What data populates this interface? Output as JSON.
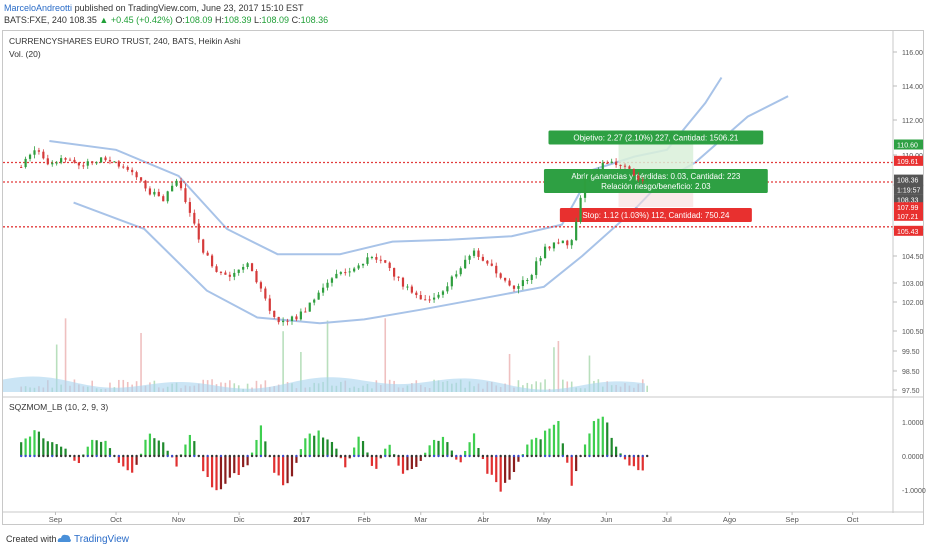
{
  "header": {
    "author": "MarceloAndreotti",
    "published": "published on TradingView.com, June 23, 2017 15:10 EST",
    "symbol_line": "BATS:FXE, 240",
    "last": "108.35",
    "change": "▲ +0.45 (+0.42%)",
    "ohlc": [
      {
        "k": "O:",
        "v": "108.09"
      },
      {
        "k": "H:",
        "v": "108.39"
      },
      {
        "k": "L:",
        "v": "108.09"
      },
      {
        "k": "C:",
        "v": "108.36"
      }
    ]
  },
  "panel": {
    "title": "CURRENCYSHARES EURO TRUST, 240, BATS, Heikin Ashi",
    "volume_label": "Vol. (20)",
    "osc_label": "SQZMOM_LB (10, 2, 9, 3)"
  },
  "colors": {
    "up": "#2e9e3e",
    "down": "#d53a3a",
    "band": "#a8c3e8",
    "hline": "#e23b3b",
    "target_fill": "#d9f0d9",
    "target_box": "#2ea043",
    "stop_box": "#e8302f",
    "price_tag": "#555555"
  },
  "chart_data": [
    {
      "type": "candlestick",
      "title": "CURRENCYSHARES EURO TRUST, 240, BATS, Heikin Ashi",
      "x_ticks": [
        "Sep",
        "Oct",
        "Nov",
        "Dic",
        "2017",
        "Feb",
        "Mar",
        "Abr",
        "May",
        "Jun",
        "Jul",
        "Ago",
        "Sep",
        "Oct"
      ],
      "y_ticks": [
        "116.00",
        "114.00",
        "112.00",
        "110.00",
        "108.00",
        "106.00",
        "104.50",
        "103.00",
        "102.00",
        "100.50",
        "99.50",
        "98.50",
        "97.50"
      ],
      "ylim": [
        97.3,
        116.5
      ],
      "price_path": [
        [
          "2016-08-15",
          109.2
        ],
        [
          "2016-08-22",
          110.5
        ],
        [
          "2016-08-29",
          109.4
        ],
        [
          "2016-09-05",
          109.9
        ],
        [
          "2016-09-12",
          109.3
        ],
        [
          "2016-09-19",
          109.6
        ],
        [
          "2016-09-26",
          109.8
        ],
        [
          "2016-10-03",
          109.2
        ],
        [
          "2016-10-10",
          108.6
        ],
        [
          "2016-10-17",
          107.8
        ],
        [
          "2016-10-24",
          107.2
        ],
        [
          "2016-10-31",
          108.2
        ],
        [
          "2016-11-07",
          106.6
        ],
        [
          "2016-11-14",
          104.6
        ],
        [
          "2016-11-21",
          103.6
        ],
        [
          "2016-11-28",
          103.3
        ],
        [
          "2016-12-05",
          104.3
        ],
        [
          "2016-12-12",
          102.6
        ],
        [
          "2016-12-19",
          101.0
        ],
        [
          "2016-12-26",
          101.1
        ],
        [
          "2017-01-02",
          101.4
        ],
        [
          "2017-01-09",
          102.6
        ],
        [
          "2017-01-16",
          103.2
        ],
        [
          "2017-01-23",
          103.7
        ],
        [
          "2017-01-30",
          104.1
        ],
        [
          "2017-02-06",
          104.5
        ],
        [
          "2017-02-13",
          103.8
        ],
        [
          "2017-02-20",
          103.0
        ],
        [
          "2017-02-27",
          102.4
        ],
        [
          "2017-03-06",
          102.0
        ],
        [
          "2017-03-13",
          102.8
        ],
        [
          "2017-03-20",
          103.7
        ],
        [
          "2017-03-27",
          104.8
        ],
        [
          "2017-04-03",
          104.1
        ],
        [
          "2017-04-10",
          103.1
        ],
        [
          "2017-04-17",
          102.6
        ],
        [
          "2017-04-24",
          103.4
        ],
        [
          "2017-05-01",
          104.9
        ],
        [
          "2017-05-08",
          105.2
        ],
        [
          "2017-05-15",
          105.3
        ],
        [
          "2017-05-22",
          108.6
        ],
        [
          "2017-05-29",
          109.3
        ],
        [
          "2017-06-05",
          109.5
        ],
        [
          "2017-06-12",
          109.0
        ],
        [
          "2017-06-19",
          108.2
        ],
        [
          "2017-06-23",
          108.36
        ]
      ],
      "bollinger_upper": [
        [
          "2016-08-29",
          110.8
        ],
        [
          "2016-10-01",
          110.3
        ],
        [
          "2016-11-01",
          108.6
        ],
        [
          "2016-11-25",
          106.0
        ],
        [
          "2016-12-20",
          104.6
        ],
        [
          "2017-01-20",
          104.6
        ],
        [
          "2017-02-15",
          105.3
        ],
        [
          "2017-03-15",
          105.4
        ],
        [
          "2017-04-15",
          105.6
        ],
        [
          "2017-05-10",
          106.2
        ],
        [
          "2017-05-25",
          109.0
        ],
        [
          "2017-06-15",
          109.9
        ],
        [
          "2017-07-01",
          110.3
        ],
        [
          "2017-07-20",
          113.0
        ],
        [
          "2017-07-28",
          114.5
        ]
      ],
      "bollinger_lower": [
        [
          "2016-09-10",
          107.2
        ],
        [
          "2016-10-15",
          106.0
        ],
        [
          "2016-11-15",
          102.6
        ],
        [
          "2016-12-10",
          101.2
        ],
        [
          "2017-01-10",
          100.9
        ],
        [
          "2017-02-01",
          101.1
        ],
        [
          "2017-03-01",
          101.6
        ],
        [
          "2017-04-01",
          102.2
        ],
        [
          "2017-05-01",
          102.8
        ],
        [
          "2017-05-20",
          104.5
        ],
        [
          "2017-06-15",
          106.9
        ],
        [
          "2017-06-28",
          108.2
        ],
        [
          "2017-07-15",
          109.5
        ],
        [
          "2017-08-10",
          112.2
        ],
        [
          "2017-08-30",
          113.4
        ]
      ],
      "horizontal_lines": [
        109.5,
        108.2,
        106.1
      ],
      "price_tags": [
        {
          "label": "110.60",
          "y": 110.6,
          "color": "#2ea043"
        },
        {
          "label": "109.61",
          "y": 109.61,
          "color": "#e8302f"
        },
        {
          "label": "108.36",
          "y": 108.36,
          "color": "#555555"
        },
        {
          "label": "1:19:57",
          "y": 107.8,
          "color": "#555555"
        },
        {
          "label": "108.33",
          "y": 107.35,
          "color": "#555555"
        },
        {
          "label": "107.99",
          "y": 106.99,
          "color": "#e8302f"
        },
        {
          "label": "107.21",
          "y": 106.6,
          "color": "#e8302f"
        },
        {
          "label": "105.43",
          "y": 105.9,
          "color": "#e8302f"
        }
      ],
      "position_tool": {
        "start": "2017-06-07",
        "end": "2017-07-14",
        "entry": 108.2,
        "target": 110.6,
        "stop": 107.0,
        "labels": {
          "target": "Objetivo: 2.27 (2.10%) 227, Cantidad: 1506.21",
          "open_pl": "Abrir ganancias y pérdidas: 0.03, Cantidad: 223",
          "rr": "Relación riesgo/beneficio: 2.03",
          "stop": "Stop: 1.12 (1.03%) 112, Cantidad: 750.24"
        }
      }
    },
    {
      "type": "histogram",
      "name": "SQZMOM_LB (10, 2, 9, 3)",
      "y_ticks": [
        "1.0000",
        "0.0000",
        "-1.0000"
      ],
      "ylim": [
        -1.7,
        1.75
      ],
      "series": [
        [
          "2016-08-15",
          0.45
        ],
        [
          "2016-08-22",
          0.75
        ],
        [
          "2016-08-29",
          0.5
        ],
        [
          "2016-09-05",
          0.3
        ],
        [
          "2016-09-12",
          -0.3
        ],
        [
          "2016-09-19",
          0.6
        ],
        [
          "2016-09-26",
          0.5
        ],
        [
          "2016-10-03",
          -0.3
        ],
        [
          "2016-10-10",
          -0.5
        ],
        [
          "2016-10-17",
          0.7
        ],
        [
          "2016-10-24",
          0.5
        ],
        [
          "2016-10-31",
          -0.3
        ],
        [
          "2016-11-07",
          0.85
        ],
        [
          "2016-11-14",
          -0.6
        ],
        [
          "2016-11-21",
          -1.35
        ],
        [
          "2016-11-28",
          -0.7
        ],
        [
          "2016-12-05",
          -0.3
        ],
        [
          "2016-12-12",
          0.95
        ],
        [
          "2016-12-19",
          -0.7
        ],
        [
          "2016-12-26",
          -0.95
        ],
        [
          "2017-01-02",
          0.5
        ],
        [
          "2017-01-09",
          0.8
        ],
        [
          "2017-01-16",
          0.5
        ],
        [
          "2017-01-23",
          -0.4
        ],
        [
          "2017-01-30",
          0.85
        ],
        [
          "2017-02-06",
          -0.55
        ],
        [
          "2017-02-13",
          0.5
        ],
        [
          "2017-02-20",
          -0.6
        ],
        [
          "2017-02-27",
          -0.4
        ],
        [
          "2017-03-06",
          0.45
        ],
        [
          "2017-03-13",
          0.6
        ],
        [
          "2017-03-20",
          -0.3
        ],
        [
          "2017-03-27",
          0.75
        ],
        [
          "2017-04-03",
          -0.5
        ],
        [
          "2017-04-10",
          -1.2
        ],
        [
          "2017-04-17",
          -0.4
        ],
        [
          "2017-04-24",
          0.5
        ],
        [
          "2017-05-01",
          0.7
        ],
        [
          "2017-05-08",
          1.05
        ],
        [
          "2017-05-15",
          -0.9
        ],
        [
          "2017-05-22",
          0.55
        ],
        [
          "2017-05-29",
          1.6
        ],
        [
          "2017-06-05",
          0.4
        ],
        [
          "2017-06-12",
          -0.3
        ],
        [
          "2017-06-19",
          -0.45
        ],
        [
          "2017-06-23",
          0.35
        ]
      ]
    }
  ],
  "footer": {
    "created_with": "Created with",
    "brand": "TradingView"
  }
}
